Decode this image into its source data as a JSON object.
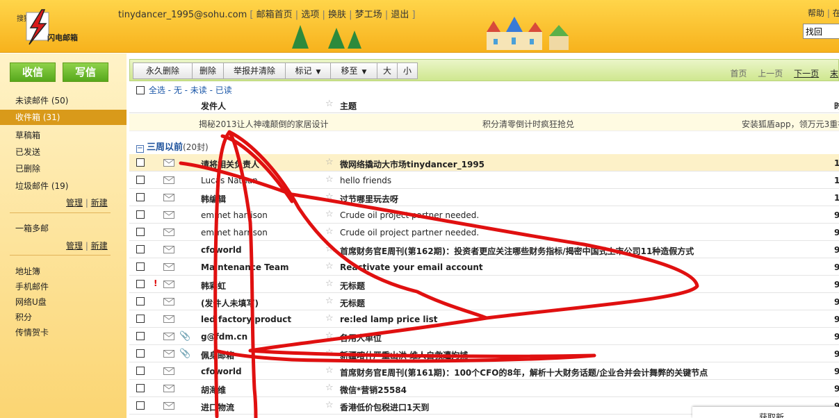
{
  "header": {
    "logo_sub": "搜狐",
    "logo_name": "闪电邮箱",
    "email": "tinydancer_1995@sohu.com",
    "links": [
      "邮箱首页",
      "选项",
      "换肤",
      "梦工场",
      "退出"
    ],
    "help": "帮助",
    "help_more": "在",
    "search_value": "找回"
  },
  "sidebar": {
    "receive_label": "收信",
    "compose_label": "写信",
    "folders": [
      {
        "label": "未读邮件",
        "count": "(50)"
      },
      {
        "label": "收件箱",
        "count": "(31)"
      },
      {
        "label": "草稿箱",
        "count": ""
      },
      {
        "label": "已发送",
        "count": ""
      },
      {
        "label": "已删除",
        "count": ""
      },
      {
        "label": "垃圾邮件",
        "count": "(19)"
      }
    ],
    "manage": "管理",
    "new": "新建",
    "multi": "一箱多邮",
    "manage2": "管理",
    "new2": "新建",
    "tools": [
      "地址簿",
      "手机邮件",
      "网络U盘",
      "积分",
      "传情贺卡"
    ]
  },
  "toolbar": {
    "buttons": [
      "永久删除",
      "删除",
      "举报并清除",
      "标记",
      "移至",
      "大",
      "小"
    ],
    "pager": {
      "first": "首页",
      "prev": "上一页",
      "next": "下一页",
      "more": "末"
    }
  },
  "select_row": {
    "all": "全选",
    "none": "无",
    "unread": "未读",
    "read": "已读"
  },
  "columns": {
    "sender": "发件人",
    "subject": "主题",
    "time": "时"
  },
  "ads": [
    "揭秘2013让人神魂颠倒的家居设计",
    "积分清零倒计时疯狂抢兑",
    "安装狐盾app，领万元3重礼"
  ],
  "group": {
    "label": "三周以前",
    "count": "(20封)"
  },
  "emails": [
    {
      "sender": "请将相关负责人",
      "subject": "微网络撬动大市场tinydancer_1995",
      "time": "1",
      "unread": true,
      "flag": false,
      "attach": false
    },
    {
      "sender": "Lucas Nathan",
      "subject": "hello friends",
      "time": "1",
      "unread": false,
      "flag": false,
      "attach": false
    },
    {
      "sender": "韩编辑",
      "subject": "过节哪里玩去呀",
      "time": "1",
      "unread": true,
      "flag": false,
      "attach": false
    },
    {
      "sender": "emmet harrison",
      "subject": "Crude oil project partner needed.",
      "time": "9",
      "unread": false,
      "flag": false,
      "attach": false
    },
    {
      "sender": "emmet harrison",
      "subject": "Crude oil project partner needed.",
      "time": "9",
      "unread": false,
      "flag": false,
      "attach": false
    },
    {
      "sender": "cfoworld",
      "subject": "首席财务官E周刊(第162期)：投资者更应关注哪些财务指标/揭密中国式上市公司11种造假方式",
      "time": "9",
      "unread": true,
      "flag": false,
      "attach": false
    },
    {
      "sender": "Maintenance Team",
      "subject": "Reactivate your email account",
      "time": "9",
      "unread": true,
      "flag": false,
      "attach": false
    },
    {
      "sender": "韩彩虹",
      "subject": "无标题",
      "time": "9",
      "unread": true,
      "flag": true,
      "attach": false
    },
    {
      "sender": "(发件人未填写)",
      "subject": "无标题",
      "time": "9",
      "unread": true,
      "flag": false,
      "attach": false
    },
    {
      "sender": "led factory product",
      "subject": "re:led lamp price list",
      "time": "9",
      "unread": true,
      "flag": false,
      "attach": false
    },
    {
      "sender": "g@fdm.cn",
      "subject": "各用人单位",
      "time": "9",
      "unread": true,
      "flag": false,
      "attach": true
    },
    {
      "sender": "佩身邮箱",
      "subject": "新疆喀什严重山洪 维人自救遭拘捕",
      "time": "9",
      "unread": true,
      "flag": false,
      "attach": true
    },
    {
      "sender": "cfoworld",
      "subject": "首席财务官E周刊(第161期)：100个CFO的8年，解析十大财务话题/企业合并会计舞弊的关键节点",
      "time": "9",
      "unread": true,
      "flag": false,
      "attach": false
    },
    {
      "sender": "胡海维",
      "subject": "微信*营销25584",
      "time": "9",
      "unread": true,
      "flag": false,
      "attach": false
    },
    {
      "sender": "进口物流",
      "subject": "香港低价包税进口1天到",
      "time": "9",
      "unread": true,
      "flag": false,
      "attach": false
    }
  ],
  "popup": {
    "text": "获取新..."
  },
  "colors": {
    "accent_green": "#6bbd2b",
    "header_yellow": "#f9c233",
    "sidebar_active": "#d99a1a",
    "scribble_red": "#e01010"
  }
}
